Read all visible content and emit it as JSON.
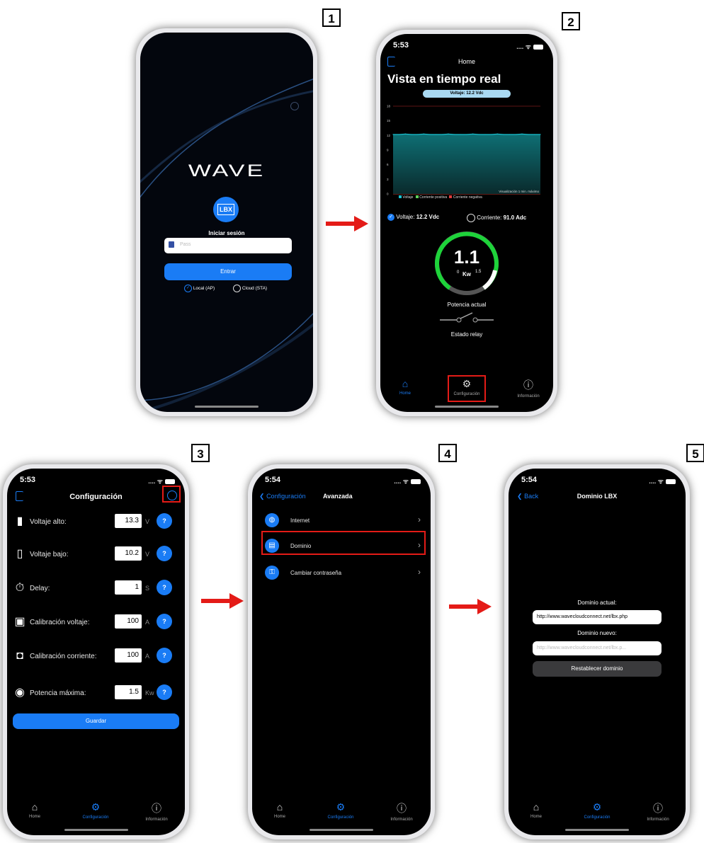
{
  "steps": [
    "1",
    "2",
    "3",
    "4",
    "5"
  ],
  "screen1": {
    "logo": "WAVE",
    "badge": "LBX",
    "login_title": "Iniciar sesión",
    "pass_placeholder": "Pass",
    "enter_button": "Entrar",
    "mode_local": "Local (AP)",
    "mode_cloud": "Cloud (STA)"
  },
  "screen2": {
    "time": "5:53",
    "nav_title": "Home",
    "heading": "Vista en tiempo real",
    "voltage_pill": "Voltaje: 12.2 Vdc",
    "chart_note": "Visualización 1 min. máximo",
    "legend": [
      "Voltaje",
      "Corriente positiva",
      "Corriente negativa"
    ],
    "readout_voltage_label": "Voltaje:",
    "readout_voltage_value": "12.2 Vdc",
    "readout_current_label": "Corriente:",
    "readout_current_value": "91.0 Adc",
    "gauge_value": "1.1",
    "gauge_unit": "Kw",
    "gauge_min": "0",
    "gauge_max": "1.5",
    "gauge_label": "Potencia actual",
    "relay_label": "Estado relay"
  },
  "chart_data": {
    "type": "area",
    "title": "",
    "xlabel": "",
    "ylabel": "",
    "ylim": [
      0,
      18
    ],
    "yticks": [
      "18",
      "15",
      "12",
      "9",
      "6",
      "3",
      "0"
    ],
    "series": [
      {
        "name": "Voltaje",
        "color": "#19c3d2",
        "values": [
          12.2,
          12.2,
          12.3,
          12.2,
          12.2,
          12.3,
          12.2,
          12.2,
          12.2,
          12.3,
          12.2,
          12.2,
          12.2,
          12.3,
          12.2,
          12.2,
          12.2,
          12.3,
          12.2,
          12.2,
          12.2,
          12.3,
          12.2,
          12.2,
          12.2
        ]
      },
      {
        "name": "Corriente positiva",
        "color": "#5fd15a",
        "values": []
      },
      {
        "name": "Corriente negativa",
        "color": "#e23b3b",
        "values": []
      }
    ],
    "grid": false,
    "legend_position": "bottom"
  },
  "screen3": {
    "time": "5:53",
    "nav_title": "Configuración",
    "rows": [
      {
        "label": "Voltaje alto:",
        "value": "13.3",
        "unit": "V"
      },
      {
        "label": "Voltaje bajo:",
        "value": "10.2",
        "unit": "V"
      },
      {
        "label": "Delay:",
        "value": "1",
        "unit": "S"
      },
      {
        "label": "Calibración voltaje:",
        "value": "100",
        "unit": "A"
      },
      {
        "label": "Calibración corriente:",
        "value": "100",
        "unit": "A"
      },
      {
        "label": "Potencia máxima:",
        "value": "1.5",
        "unit": "Kw"
      }
    ],
    "help": "?",
    "save_button": "Guardar"
  },
  "screen4": {
    "time": "5:54",
    "back_label": "Configuración",
    "nav_title": "Avanzada",
    "items": [
      "Internet",
      "Dominio",
      "Cambiar contraseña"
    ]
  },
  "screen5": {
    "time": "5:54",
    "back_label": "Back",
    "nav_title": "Dominio LBX",
    "current_label": "Dominio actual:",
    "current_value": "http://www.wavecloudconnect.net/lbx.php",
    "new_label": "Dominio nuevo:",
    "new_placeholder": "http://www.wavecloudconnect.net/lbx.p...",
    "reset_button": "Restablecer dominio"
  },
  "tabbar": {
    "home": "Home",
    "config": "Configuración",
    "info": "Información"
  },
  "colors": {
    "accent": "#1a7cf5",
    "highlight": "#e41b17",
    "gauge_green": "#1ed33a",
    "chart_fill": "#0e6f74"
  }
}
